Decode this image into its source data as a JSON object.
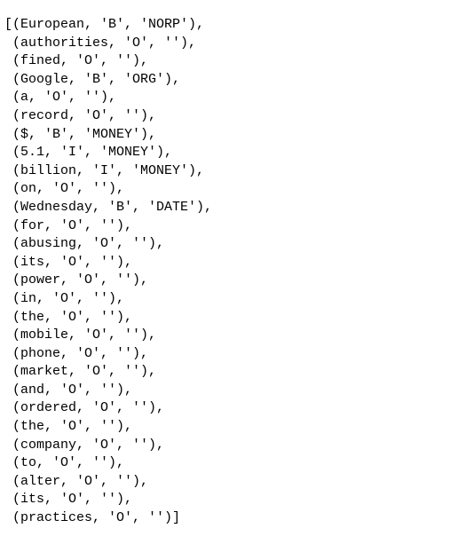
{
  "tokens": [
    {
      "word": "European",
      "tag": "'B'",
      "label": "'NORP'"
    },
    {
      "word": "authorities",
      "tag": "'O'",
      "label": "''"
    },
    {
      "word": "fined",
      "tag": "'O'",
      "label": "''"
    },
    {
      "word": "Google",
      "tag": "'B'",
      "label": "'ORG'"
    },
    {
      "word": "a",
      "tag": "'O'",
      "label": "''"
    },
    {
      "word": "record",
      "tag": "'O'",
      "label": "''"
    },
    {
      "word": "$",
      "tag": "'B'",
      "label": "'MONEY'"
    },
    {
      "word": "5.1",
      "tag": "'I'",
      "label": "'MONEY'"
    },
    {
      "word": "billion",
      "tag": "'I'",
      "label": "'MONEY'"
    },
    {
      "word": "on",
      "tag": "'O'",
      "label": "''"
    },
    {
      "word": "Wednesday",
      "tag": "'B'",
      "label": "'DATE'"
    },
    {
      "word": "for",
      "tag": "'O'",
      "label": "''"
    },
    {
      "word": "abusing",
      "tag": "'O'",
      "label": "''"
    },
    {
      "word": "its",
      "tag": "'O'",
      "label": "''"
    },
    {
      "word": "power",
      "tag": "'O'",
      "label": "''"
    },
    {
      "word": "in",
      "tag": "'O'",
      "label": "''"
    },
    {
      "word": "the",
      "tag": "'O'",
      "label": "''"
    },
    {
      "word": "mobile",
      "tag": "'O'",
      "label": "''"
    },
    {
      "word": "phone",
      "tag": "'O'",
      "label": "''"
    },
    {
      "word": "market",
      "tag": "'O'",
      "label": "''"
    },
    {
      "word": "and",
      "tag": "'O'",
      "label": "''"
    },
    {
      "word": "ordered",
      "tag": "'O'",
      "label": "''"
    },
    {
      "word": "the",
      "tag": "'O'",
      "label": "''"
    },
    {
      "word": "company",
      "tag": "'O'",
      "label": "''"
    },
    {
      "word": "to",
      "tag": "'O'",
      "label": "''"
    },
    {
      "word": "alter",
      "tag": "'O'",
      "label": "''"
    },
    {
      "word": "its",
      "tag": "'O'",
      "label": "''"
    },
    {
      "word": "practices",
      "tag": "'O'",
      "label": "''"
    }
  ]
}
